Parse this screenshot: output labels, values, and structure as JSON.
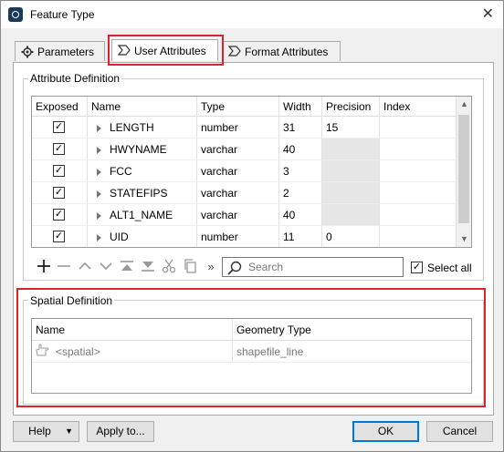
{
  "window": {
    "title": "Feature Type"
  },
  "tabs": [
    {
      "label": "Parameters",
      "icon": "gear-icon"
    },
    {
      "label": "User Attributes",
      "icon": "attribute-tag-icon"
    },
    {
      "label": "Format Attributes",
      "icon": "attribute-tag-icon"
    }
  ],
  "attribute_definition": {
    "title": "Attribute Definition",
    "columns": [
      "Exposed",
      "Name",
      "Type",
      "Width",
      "Precision",
      "Index"
    ],
    "rows": [
      {
        "exposed": true,
        "name": "LENGTH",
        "type": "number",
        "width": "31",
        "precision": "15",
        "index": "",
        "precision_disabled": false
      },
      {
        "exposed": true,
        "name": "HWYNAME",
        "type": "varchar",
        "width": "40",
        "precision": "",
        "index": "",
        "precision_disabled": true
      },
      {
        "exposed": true,
        "name": "FCC",
        "type": "varchar",
        "width": "3",
        "precision": "",
        "index": "",
        "precision_disabled": true
      },
      {
        "exposed": true,
        "name": "STATEFIPS",
        "type": "varchar",
        "width": "2",
        "precision": "",
        "index": "",
        "precision_disabled": true
      },
      {
        "exposed": true,
        "name": "ALT1_NAME",
        "type": "varchar",
        "width": "40",
        "precision": "",
        "index": "",
        "precision_disabled": true
      },
      {
        "exposed": true,
        "name": "UID",
        "type": "number",
        "width": "11",
        "precision": "0",
        "index": "",
        "precision_disabled": false
      }
    ],
    "toolbar": {
      "more": "»",
      "search_placeholder": "Search",
      "select_all_label": "Select all",
      "select_all_checked": true
    }
  },
  "spatial_definition": {
    "title": "Spatial Definition",
    "columns": [
      "Name",
      "Geometry Type"
    ],
    "rows": [
      {
        "name": "<spatial>",
        "geometry_type": "shapefile_line"
      }
    ]
  },
  "footer": {
    "help_label": "Help",
    "apply_label": "Apply to...",
    "ok_label": "OK",
    "cancel_label": "Cancel"
  },
  "colors": {
    "highlight": "#d9232d",
    "accent": "#0078d7"
  }
}
